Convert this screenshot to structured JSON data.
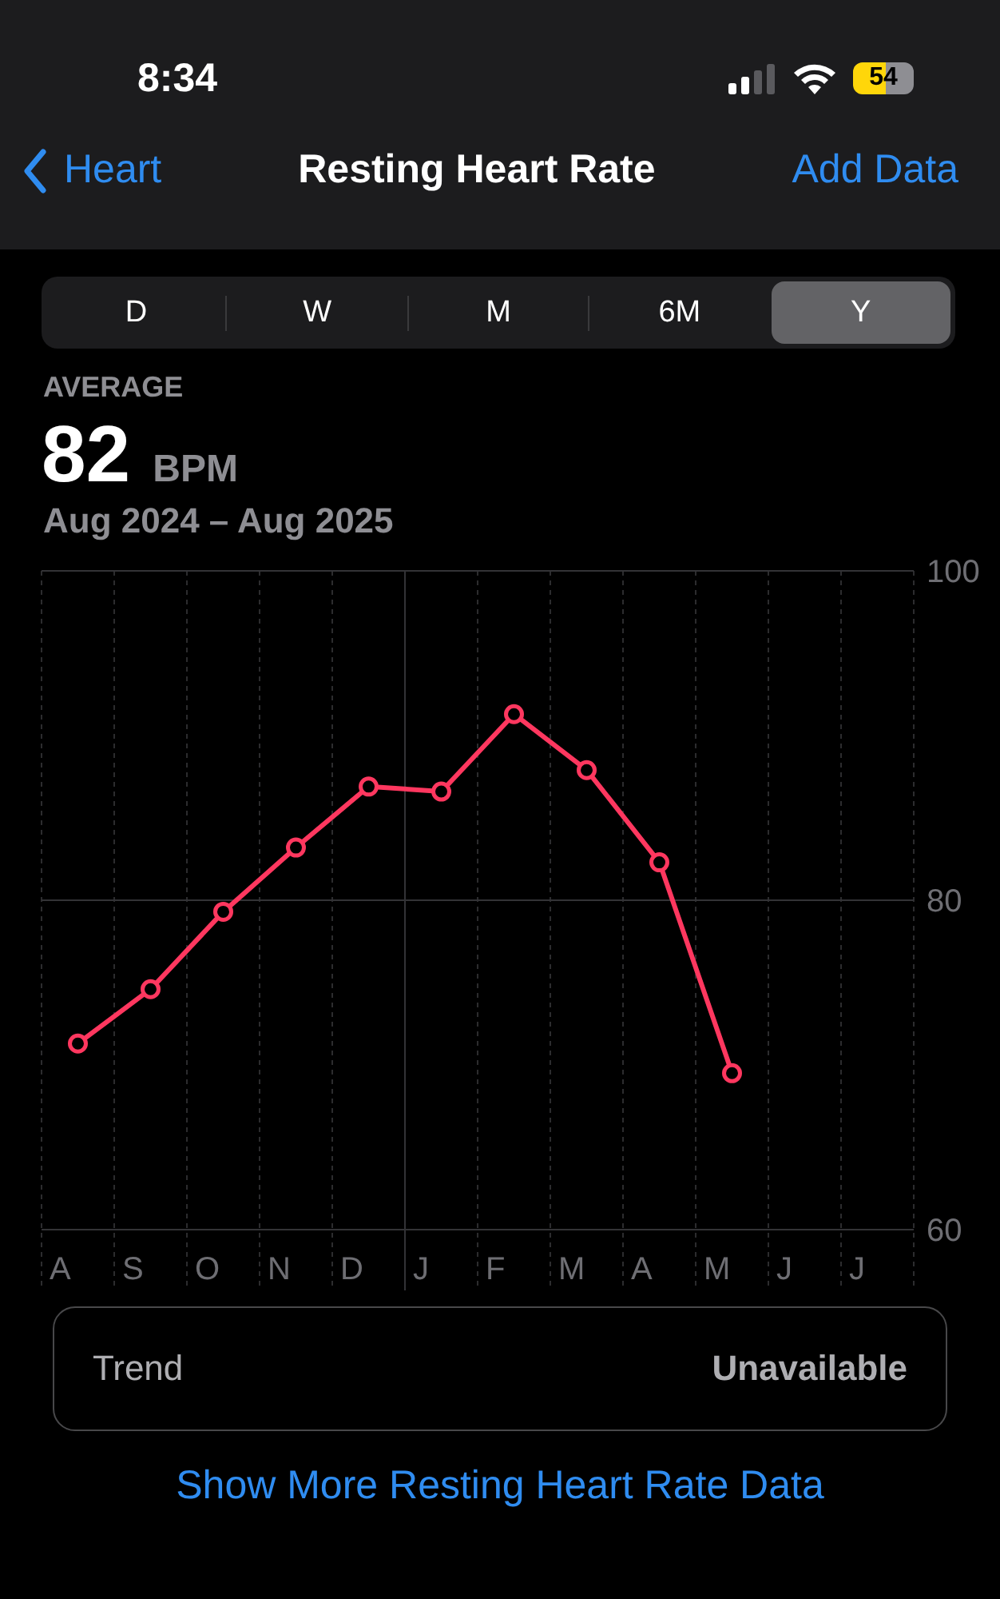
{
  "status_bar": {
    "time": "8:34",
    "battery": "54"
  },
  "nav": {
    "back": "Heart",
    "title": "Resting Heart Rate",
    "action": "Add Data"
  },
  "segments": [
    {
      "label": "D",
      "selected": false
    },
    {
      "label": "W",
      "selected": false
    },
    {
      "label": "M",
      "selected": false
    },
    {
      "label": "6M",
      "selected": false
    },
    {
      "label": "Y",
      "selected": true
    }
  ],
  "summary": {
    "label": "AVERAGE",
    "value": "82",
    "unit": "BPM",
    "range": "Aug 2024 – Aug 2025"
  },
  "chart_data": {
    "type": "line",
    "categories": [
      "A",
      "S",
      "O",
      "N",
      "D",
      "J",
      "F",
      "M",
      "A",
      "M",
      "J",
      "J"
    ],
    "series": [
      {
        "color": "#ff375f",
        "marker": "circle",
        "values": [
          71.3,
          74.6,
          79.3,
          83.2,
          86.9,
          86.6,
          91.3,
          87.9,
          82.3,
          69.5,
          null,
          null
        ]
      }
    ],
    "ylim": [
      60,
      100
    ],
    "yticks": [
      60,
      80,
      100
    ]
  },
  "trend": {
    "label": "Trend",
    "value": "Unavailable"
  },
  "more_link": "Show More Resting Heart Rate Data"
}
